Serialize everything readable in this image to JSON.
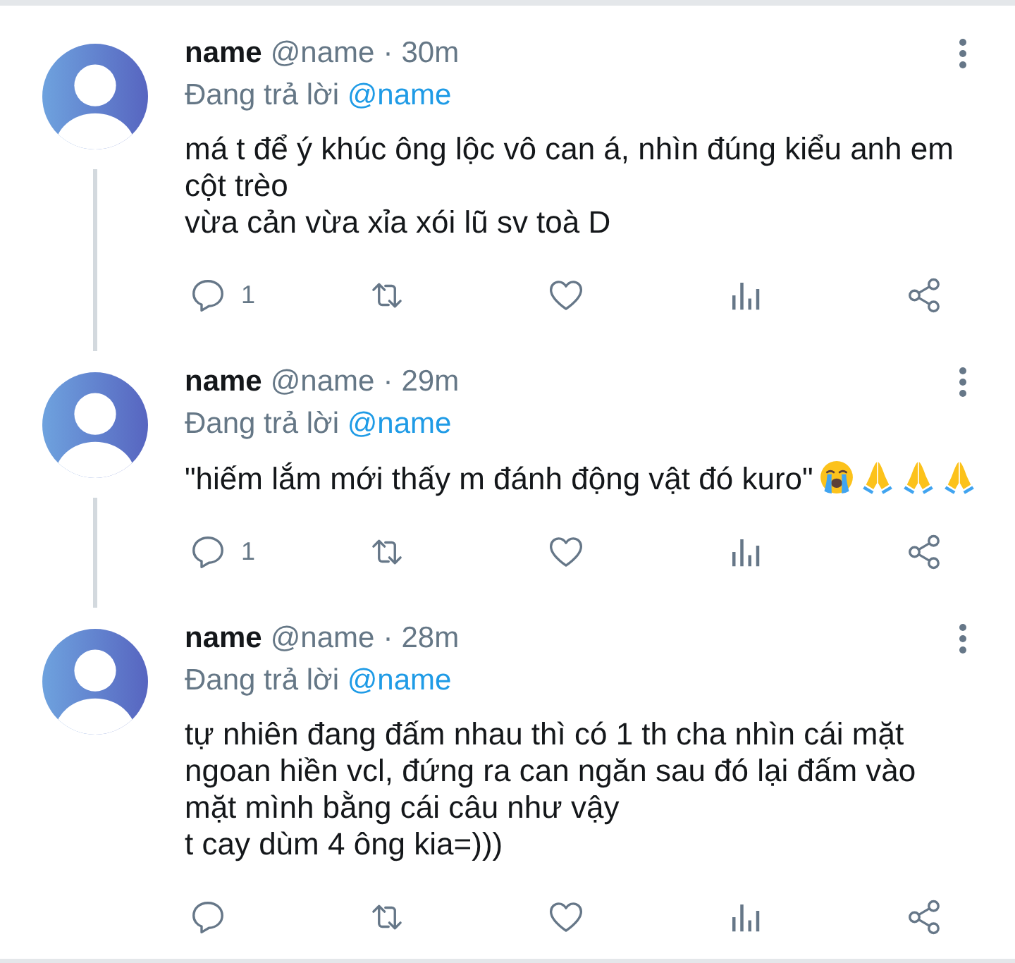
{
  "tweets": [
    {
      "author": "name",
      "handle": "@name",
      "separator": "·",
      "time": "30m",
      "replying_to": {
        "prefix": "Đang trả lời",
        "mention": "@name"
      },
      "body": "má t để ý khúc ông lộc vô can á, nhìn đúng kiểu anh em\ncột trèo\nvừa cản vừa xỉa xói lũ sv toà D",
      "reply_count": "1",
      "liked": false,
      "thread_line": true
    },
    {
      "author": "name",
      "handle": "@name",
      "separator": "·",
      "time": "29m",
      "replying_to": {
        "prefix": "Đang trả lời",
        "mention": "@name"
      },
      "body": "\"hiếm lắm mới thấy m đánh động vật đó kuro\"",
      "emojis": [
        {
          "kind": "crying-face"
        },
        {
          "kind": "folded-hands"
        },
        {
          "kind": "folded-hands"
        },
        {
          "kind": "folded-hands"
        }
      ],
      "reply_count": "1",
      "liked": false,
      "thread_line": true
    },
    {
      "author": "name",
      "handle": "@name",
      "separator": "·",
      "time": "28m",
      "replying_to": {
        "prefix": "Đang trả lời",
        "mention": "@name"
      },
      "body": "tự nhiên đang đấm nhau thì có 1 th cha nhìn cái mặt\nngoan hiền vcl, đứng ra can ngăn sau đó lại đấm vào\nmặt mình bằng cái câu như vậy\nt cay dùm 4 ông kia=)))",
      "liked": false,
      "thread_line": false
    }
  ]
}
